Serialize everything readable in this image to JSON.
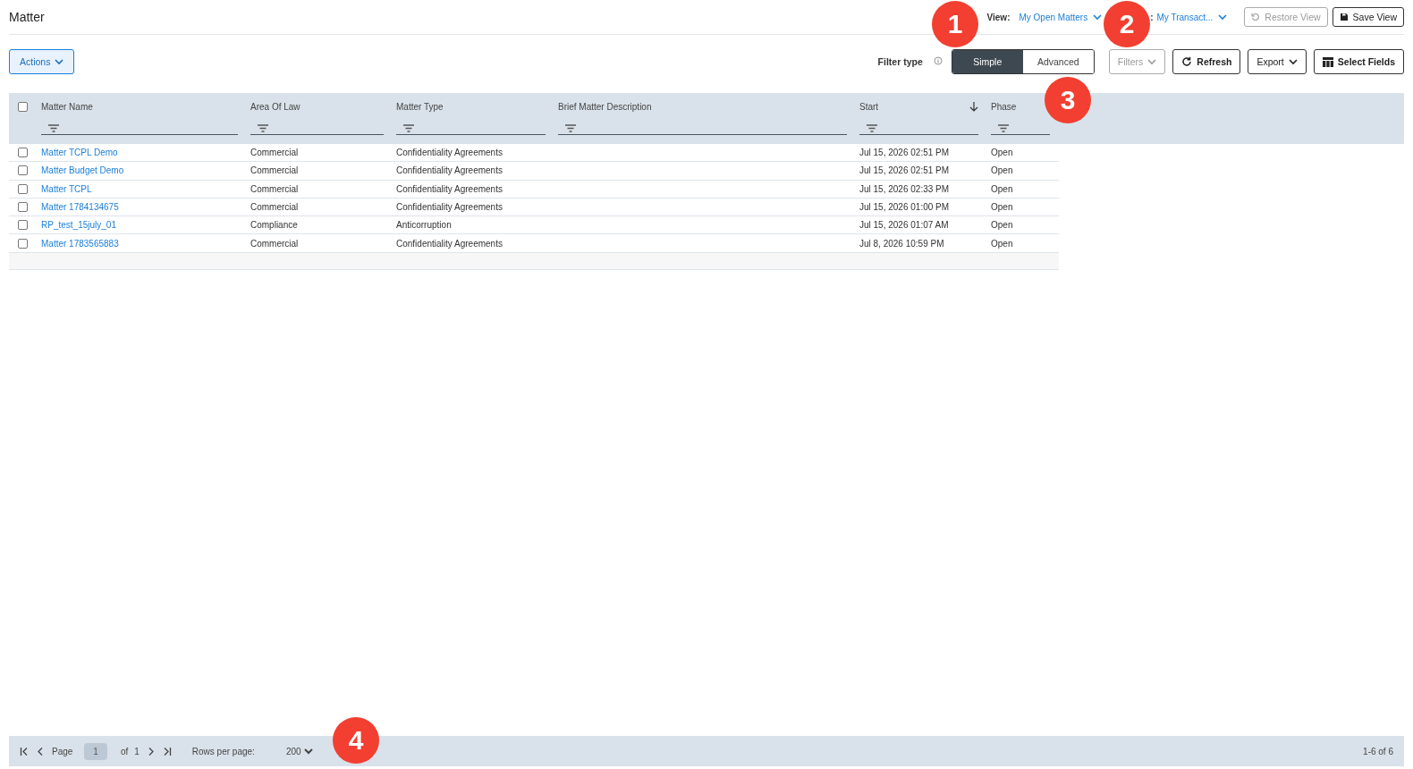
{
  "header": {
    "title": "Matter",
    "selectors": [
      {
        "label": "View:",
        "value": "My Open Matters"
      },
      {
        "label": ":",
        "value": "My Transact..."
      }
    ],
    "buttons": [
      {
        "label": "Restore View",
        "disabled": true,
        "kind": "restore"
      },
      {
        "label": "Save View",
        "disabled": false,
        "kind": "save"
      }
    ]
  },
  "toolbar": {
    "actions": "Actions",
    "filter_type_label": "Filter type",
    "filter_modes": [
      {
        "label": "Simple",
        "selected": true
      },
      {
        "label": "Advanced",
        "selected": false
      }
    ],
    "buttons": [
      {
        "label": "Filters",
        "kind": "dropdown",
        "disabled": true
      },
      {
        "label": "Refresh",
        "kind": "refresh",
        "disabled": false
      },
      {
        "label": "Export",
        "kind": "dropdown",
        "disabled": false
      },
      {
        "label": "Select Fields",
        "kind": "columns",
        "disabled": false
      }
    ]
  },
  "table": {
    "select_all_checked": false,
    "columns": [
      {
        "label": "Matter Name",
        "sorted": false
      },
      {
        "label": "Area Of Law",
        "sorted": false
      },
      {
        "label": "Matter Type",
        "sorted": false
      },
      {
        "label": "Brief Matter Description",
        "sorted": false
      },
      {
        "label": "Start",
        "sorted": true
      },
      {
        "label": "Phase",
        "sorted": false
      }
    ],
    "rows": [
      {
        "checked": false,
        "name": "Matter TCPL Demo",
        "area": "Commercial",
        "type": "Confidentiality Agreements",
        "start": "Jul 15, 2026 02:51 PM",
        "phase": "Open"
      },
      {
        "checked": false,
        "name": "Matter Budget Demo",
        "area": "Commercial",
        "type": "Confidentiality Agreements",
        "start": "Jul 15, 2026 02:51 PM",
        "phase": "Open"
      },
      {
        "checked": false,
        "name": "Matter TCPL",
        "area": "Commercial",
        "type": "Confidentiality Agreements",
        "start": "Jul 15, 2026 02:33 PM",
        "phase": "Open"
      },
      {
        "checked": false,
        "name": "Matter 1784134675",
        "area": "Commercial",
        "type": "Confidentiality Agreements",
        "start": "Jul 15, 2026 01:00 PM",
        "phase": "Open"
      },
      {
        "checked": false,
        "name": "RP_test_15july_01",
        "area": "Compliance",
        "type": "Anticorruption",
        "start": "Jul 15, 2026 01:07 AM",
        "phase": "Open"
      },
      {
        "checked": false,
        "name": "Matter 1783565883",
        "area": "Commercial",
        "type": "Confidentiality Agreements",
        "start": "Jul 8, 2026 10:59 PM",
        "phase": "Open"
      }
    ]
  },
  "pager": {
    "page_label": "Page",
    "page": "1",
    "of_label": "of",
    "total_pages": "1",
    "rows_per_page_label": "Rows per page:",
    "rows_per_page": "200",
    "summary": "1-6 of 6"
  },
  "callouts": [
    "1",
    "2",
    "3",
    "4"
  ]
}
